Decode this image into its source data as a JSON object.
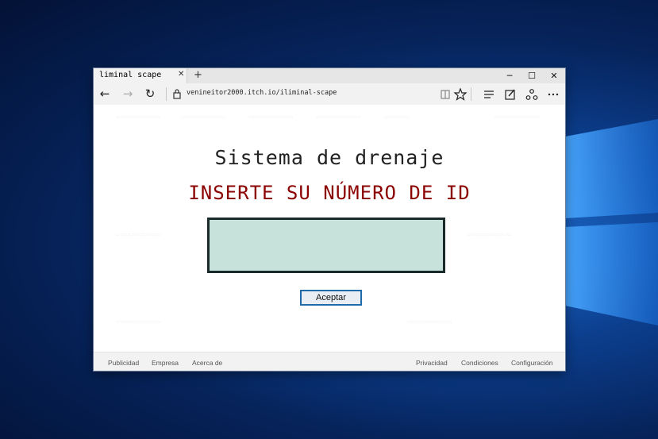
{
  "tab": {
    "title": "liminal scape",
    "close_glyph": "✕",
    "new_tab_glyph": "+"
  },
  "window_controls": {
    "minimize": "─",
    "maximize": "☐",
    "close": "✕"
  },
  "nav": {
    "back_glyph": "←",
    "forward_glyph": "→",
    "refresh_glyph": "↻",
    "url": "venineitor2000.itch.io/iliminal-scape",
    "icons": [
      "back-icon",
      "forward-icon",
      "refresh-icon",
      "lock-icon",
      "reading-view-icon",
      "favorite-star-icon",
      "hub-icon",
      "web-note-icon",
      "share-icon",
      "more-icon"
    ]
  },
  "page": {
    "title": "Sistema de drenaje",
    "subtitle": "INSERTE SU NÚMERO DE ID",
    "id_input_value": "",
    "accept_label": "Aceptar"
  },
  "footer": {
    "left": [
      "Publicidad",
      "Empresa",
      "Acerca de"
    ],
    "right": [
      "Privacidad",
      "Condiciones",
      "Configuración"
    ]
  },
  "colors": {
    "title": "#222222",
    "subtitle": "#8b0000",
    "input_bg": "#c6e2da",
    "input_border": "#1a2a2a",
    "button_border": "#1f6aa8",
    "desktop_accent": "#1f6fd1"
  }
}
